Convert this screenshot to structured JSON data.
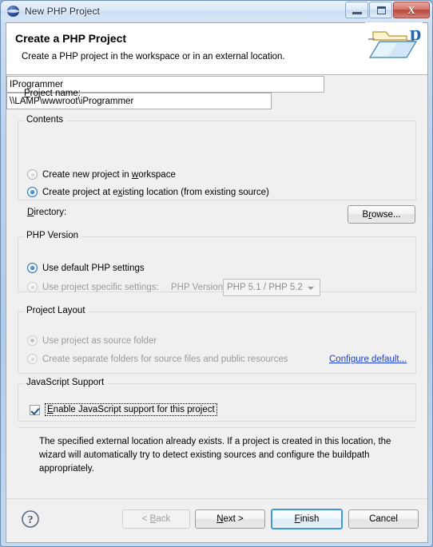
{
  "window": {
    "title": "New PHP Project",
    "icon": "php-globe-icon",
    "buttons": {
      "minimize": "minimize-button",
      "maximize": "maximize-button",
      "close_glyph": "X"
    }
  },
  "header": {
    "title": "Create a PHP Project",
    "subtitle": "Create a PHP project in the workspace or in an external location.",
    "icon": "php-folder-icon"
  },
  "form": {
    "project_name_label": "Project name:",
    "project_name_mnemonic": "P",
    "project_name_value": "IProgrammer",
    "project_name_placeholder": ""
  },
  "contents": {
    "group_label": "Contents",
    "options": [
      {
        "label_pre": "Create new project in ",
        "mnemonic": "w",
        "label_post": "orkspace",
        "selected": false,
        "disabled": false
      },
      {
        "label_pre": "Create project at e",
        "mnemonic": "x",
        "label_post": "isting location (from existing source)",
        "selected": true,
        "disabled": false
      }
    ],
    "directory_label": "Directory:",
    "directory_mnemonic": "D",
    "directory_value": "\\\\LAMP\\wwwroot\\iProgrammer",
    "browse_label_pre": "B",
    "browse_mnemonic": "r",
    "browse_label_post": "owse..."
  },
  "php_version": {
    "group_label": "PHP Version",
    "options": [
      {
        "label": "Use default PHP settings",
        "selected": true,
        "disabled": false
      },
      {
        "label": "Use project specific settings:",
        "selected": false,
        "disabled": true
      }
    ],
    "combo_label": "PHP Version:",
    "combo_value": "PHP 5.1 / PHP 5.2",
    "combo_disabled": true
  },
  "project_layout": {
    "group_label": "Project Layout",
    "options": [
      {
        "label": "Use project as source folder",
        "selected": true,
        "disabled": true
      },
      {
        "label": "Create separate folders for source files and public resources",
        "selected": false,
        "disabled": true
      }
    ],
    "configure_link": "Configure default..."
  },
  "javascript_support": {
    "group_label": "JavaScript Support",
    "checkbox_label": "Enable JavaScript support for this project",
    "checked": true,
    "focused": true
  },
  "description": {
    "text": "The specified external location already exists. If a project is created in this location, the wizard will automatically try to detect existing sources and configure the buildpath appropriately."
  },
  "footer": {
    "help_icon": "help-question-icon",
    "buttons": [
      {
        "name": "back",
        "label_pre": "< ",
        "mnemonic": "B",
        "label_post": "ack",
        "disabled": true,
        "default": false
      },
      {
        "name": "next",
        "label_pre": "",
        "mnemonic": "N",
        "label_post": "ext >",
        "disabled": false,
        "default": false
      },
      {
        "name": "finish",
        "label_pre": "",
        "mnemonic": "F",
        "label_post": "inish",
        "disabled": false,
        "default": true
      },
      {
        "name": "cancel",
        "label_pre": "Cancel",
        "mnemonic": "",
        "label_post": "",
        "disabled": false,
        "default": false
      }
    ]
  },
  "colors": {
    "accent": "#3c99dc",
    "link": "#1a3ed0",
    "dialog_bg": "#f0f0f0",
    "header_bg": "#ffffff"
  }
}
